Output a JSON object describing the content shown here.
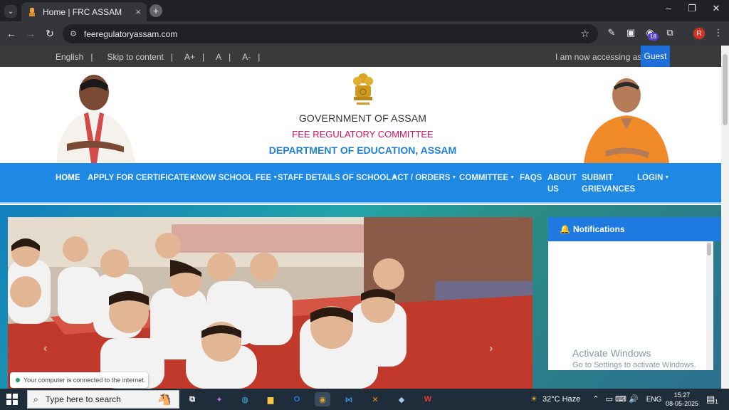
{
  "browser": {
    "tab_title": "Home | FRC ASSAM",
    "tab_close": "×",
    "new_tab": "+",
    "url": "feeregulatoryassam.com",
    "extension_badge": "18",
    "profile_initial": "R",
    "window_controls": [
      "–",
      "❐",
      "✕"
    ]
  },
  "accessibility_bar": {
    "items": [
      "English",
      "Skip to content",
      "A+",
      "A",
      "A-"
    ],
    "separator": "|",
    "accessing_label": "I am now accessing as :",
    "user": "Guest"
  },
  "banner": {
    "line1": "GOVERNMENT OF ASSAM",
    "line2": "FEE REGULATORY COMMITTEE",
    "line3": "DEPARTMENT OF EDUCATION, ASSAM"
  },
  "nav": {
    "items": [
      {
        "label": "HOME",
        "dropdown": false
      },
      {
        "label": "APPLY FOR CERTIFICATE",
        "dropdown": true
      },
      {
        "label": "KNOW SCHOOL FEE",
        "dropdown": true
      },
      {
        "label": "STAFF DETAILS OF SCHOOL",
        "dropdown": true
      },
      {
        "label": "ACT / ORDERS",
        "dropdown": true
      },
      {
        "label": "COMMITTEE",
        "dropdown": true
      },
      {
        "label": "FAQS",
        "dropdown": false
      },
      {
        "label": "ABOUT US",
        "dropdown": false
      },
      {
        "label": "SUBMIT GRIEVANCES",
        "dropdown": false
      },
      {
        "label": "LOGIN",
        "dropdown": true
      }
    ]
  },
  "notifications": {
    "title": "Notifications"
  },
  "overlay": {
    "activate_title": "Activate Windows",
    "activate_sub": "Go to Settings to activate Windows.",
    "toast": "Your computer is connected to the internet."
  },
  "taskbar": {
    "search_placeholder": "Type here to search",
    "weather": "32°C  Haze",
    "lang": "ENG",
    "time": "15:27",
    "date": "08-05-2025",
    "notification_count": "1"
  },
  "colors": {
    "nav_blue": "#1e88e5",
    "guest_blue": "#1e6fd9",
    "frc_pink": "#d6105a",
    "doe_blue": "#1f7fd6"
  }
}
